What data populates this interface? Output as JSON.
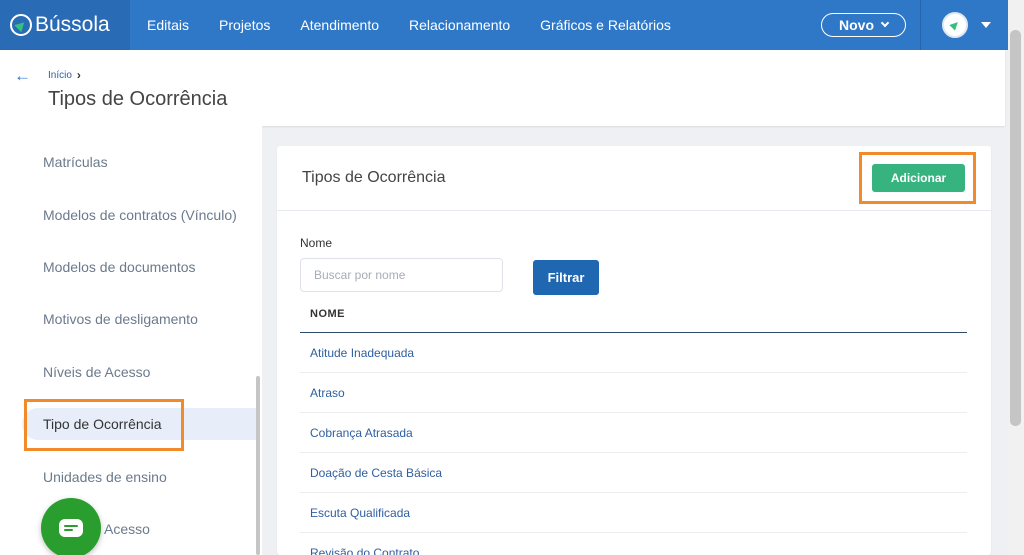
{
  "app": {
    "name": "Bússola"
  },
  "nav": {
    "items": [
      "Editais",
      "Projetos",
      "Atendimento",
      "Relacionamento",
      "Gráficos e Relatórios"
    ],
    "novo_label": "Novo"
  },
  "breadcrumb": {
    "home": "Início",
    "separator": "›"
  },
  "page": {
    "title": "Tipos de Ocorrência"
  },
  "sidebar": {
    "items": [
      "Matrículas",
      "Modelos de contratos (Vínculo)",
      "Modelos de documentos",
      "Motivos de desligamento",
      "Níveis de Acesso",
      "Tipo de Ocorrência",
      "Unidades de ensino",
      "Acesso"
    ],
    "active": "Tipo de Ocorrência"
  },
  "card": {
    "title": "Tipos de Ocorrência",
    "add_label": "Adicionar",
    "filter": {
      "label": "Nome",
      "placeholder": "Buscar por nome",
      "button": "Filtrar"
    },
    "table": {
      "header": "NOME",
      "rows": [
        "Atitude Inadequada",
        "Atraso",
        "Cobrança Atrasada",
        "Doação de Cesta Básica",
        "Escuta Qualificada",
        "Revisão do Contrato"
      ]
    }
  },
  "colors": {
    "primary": "#2f78c8",
    "success": "#36b37e",
    "highlight": "#f08a2a",
    "chat": "#2a9d2f"
  }
}
